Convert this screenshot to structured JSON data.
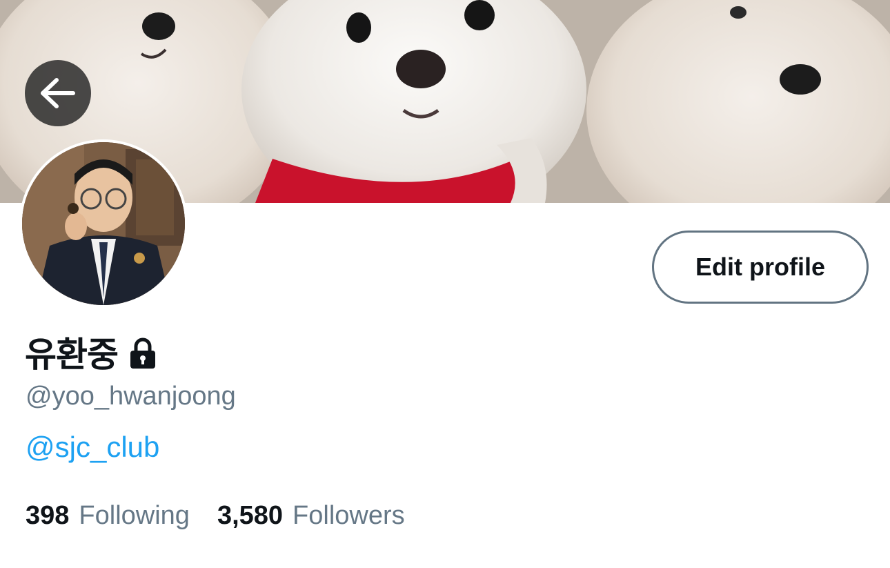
{
  "profile": {
    "display_name": "유환중",
    "handle": "@yoo_hwanjoong",
    "bio_link": "@sjc_club",
    "protected": true
  },
  "actions": {
    "edit_profile_label": "Edit profile"
  },
  "stats": {
    "following_count": "398",
    "following_label": "Following",
    "followers_count": "3,580",
    "followers_label": "Followers"
  },
  "icons": {
    "back": "arrow-left-icon",
    "lock": "lock-icon"
  },
  "colors": {
    "text_primary": "#0f1419",
    "text_secondary": "#657786",
    "link": "#1da1f2",
    "button_border": "#627482"
  }
}
